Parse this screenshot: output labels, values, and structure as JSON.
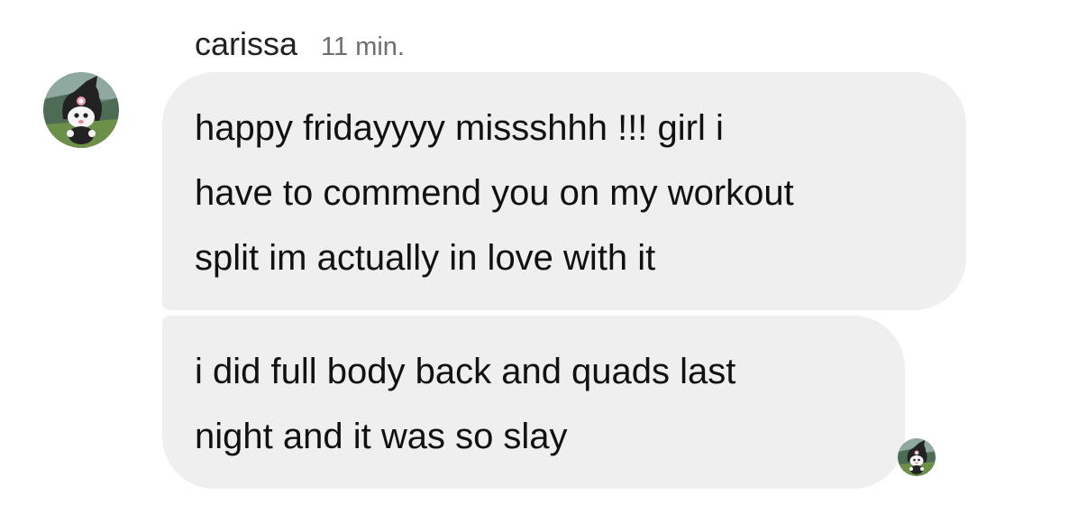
{
  "header": {
    "sender_name": "carissa",
    "timestamp": "11 min."
  },
  "avatar": {
    "icon": "kuromi-avatar-icon"
  },
  "messages": [
    {
      "lines": [
        "happy fridayyyy missshhh !!! girl i",
        "have to commend you on my workout",
        "split im actually in love with it"
      ]
    },
    {
      "lines": [
        "i did full body back and quads last",
        "night and it was so slay"
      ]
    }
  ],
  "read_receipt": {
    "icon": "kuromi-seen-avatar-icon"
  },
  "colors": {
    "bubble_background": "#efefef",
    "text_primary": "#111111",
    "text_secondary": "#6e6e6e"
  }
}
